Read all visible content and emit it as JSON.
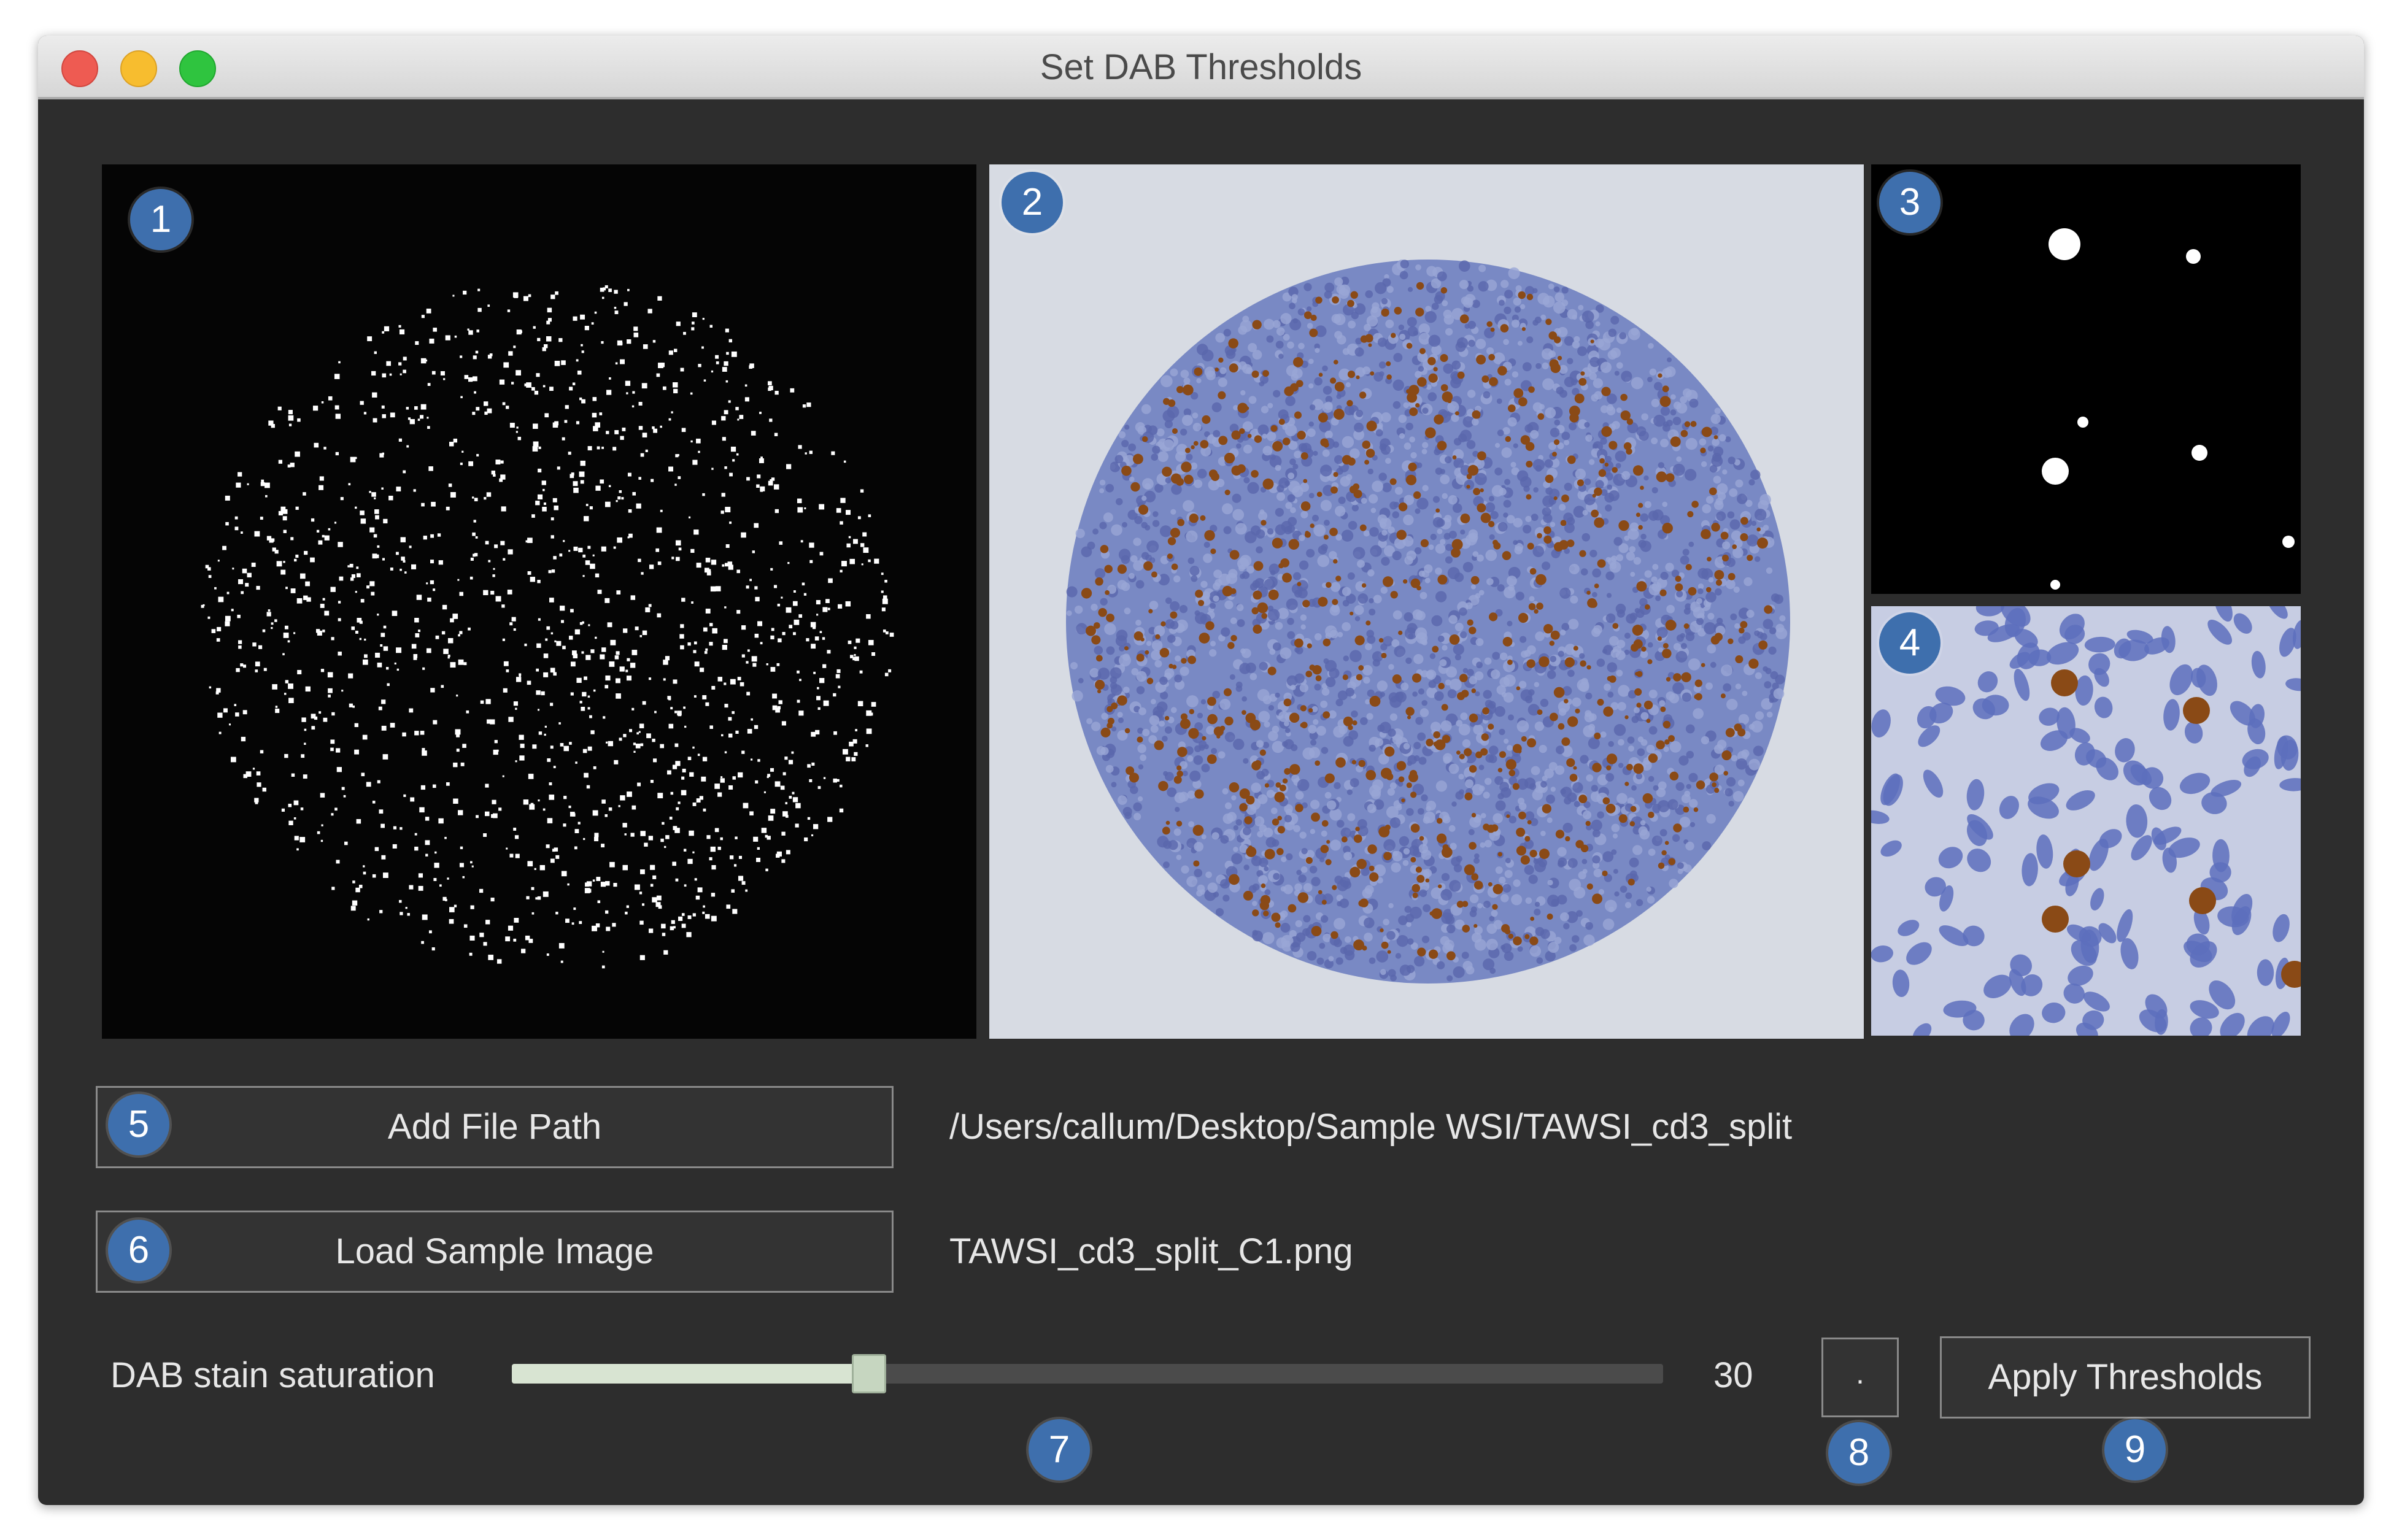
{
  "window": {
    "title": "Set DAB Thresholds"
  },
  "badges": {
    "b1": "1",
    "b2": "2",
    "b3": "3",
    "b4": "4",
    "b5": "5",
    "b6": "6",
    "b7": "7",
    "b8": "8",
    "b9": "9"
  },
  "panels": {
    "threshold_mask": "white dot threshold mask of tissue core",
    "sample_image": "DAB stained tissue core",
    "mask_zoom": "zoomed threshold mask",
    "image_zoom": "zoomed stained tissue"
  },
  "controls": {
    "add_file_path_label": "Add File Path",
    "file_path": "/Users/callum/Desktop/Sample WSI/TAWSI_cd3_split",
    "load_sample_label": "Load Sample Image",
    "sample_filename": "TAWSI_cd3_split_C1.png",
    "slider_label": "DAB stain saturation",
    "slider_value": "30",
    "slider_fraction": 0.31,
    "small_button_label": ".",
    "apply_label": "Apply Thresholds"
  },
  "colors": {
    "window_bg": "#2d2d2d",
    "badge": "#3e6fad",
    "hematoxylin": "#6f7fc0",
    "dab": "#8a4a16",
    "slider_fill": "#d8e4d2"
  }
}
